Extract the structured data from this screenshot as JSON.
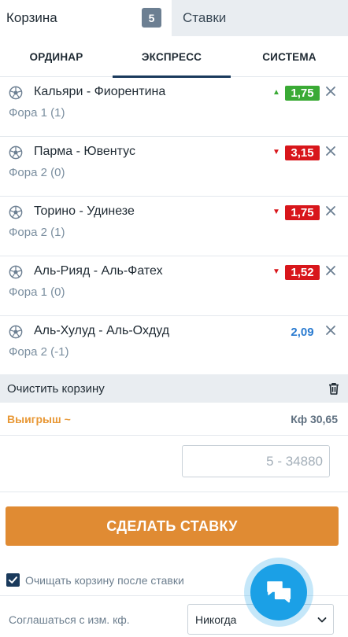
{
  "top_tabs": {
    "cart_label": "Корзина",
    "cart_count": "5",
    "bets_label": "Ставки"
  },
  "sub_tabs": [
    "ОРДИНАР",
    "ЭКСПРЕСС",
    "СИСТЕМА"
  ],
  "active_sub_tab": "ЭКСПРЕСС",
  "bets": [
    {
      "match": "Кальяри - Фиорентина",
      "market": "Фора 1 (1)",
      "odds": "1,75",
      "trend": "up"
    },
    {
      "match": "Парма - Ювентус",
      "market": "Фора 2 (0)",
      "odds": "3,15",
      "trend": "down"
    },
    {
      "match": "Торино - Удинезе",
      "market": "Фора 2 (1)",
      "odds": "1,75",
      "trend": "down"
    },
    {
      "match": "Аль-Рияд - Аль-Фатех",
      "market": "Фора 1 (0)",
      "odds": "1,52",
      "trend": "down"
    },
    {
      "match": "Аль-Хулуд - Аль-Охдуд",
      "market": "Фора 2 (-1)",
      "odds": "2,09",
      "trend": "none"
    }
  ],
  "clear_cart_label": "Очистить корзину",
  "winnings": {
    "label": "Выигрыш",
    "tilde": "~",
    "coefficient": "Кф 30,65"
  },
  "stake": {
    "value": "",
    "placeholder": "5 - 34880"
  },
  "place_bet_label": "СДЕЛАТЬ СТАВКУ",
  "clear_after_bet": {
    "label": "Очищать корзину после ставки",
    "checked": true
  },
  "agree_odds": {
    "label": "Соглашаться с изм. кф.",
    "selected": "Никогда"
  },
  "colors": {
    "accent": "#e08b33",
    "odds_up": "#3aaa35",
    "odds_down": "#d8161b",
    "odds_plain": "#2a7bd0",
    "chat": "#1ba0e6"
  },
  "icons": {
    "sport": "soccer-ball-icon",
    "remove": "close-icon",
    "trash": "trash-icon",
    "chevron": "chevron-down-icon",
    "chat": "chat-bubbles-icon",
    "check": "checkmark-icon"
  }
}
